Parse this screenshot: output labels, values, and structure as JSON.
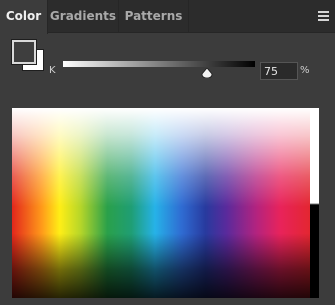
{
  "tabs": {
    "color": "Color",
    "gradients": "Gradients",
    "patterns": "Patterns"
  },
  "panel": {
    "foreground_color": "#3e3e3e",
    "background_color": "#ffffff"
  },
  "slider": {
    "label": "K",
    "value": "75",
    "unit": "%",
    "position_fraction": 0.75
  },
  "icons": {
    "menu": "hamburger-menu-icon",
    "thumb": "slider-thumb-icon"
  }
}
